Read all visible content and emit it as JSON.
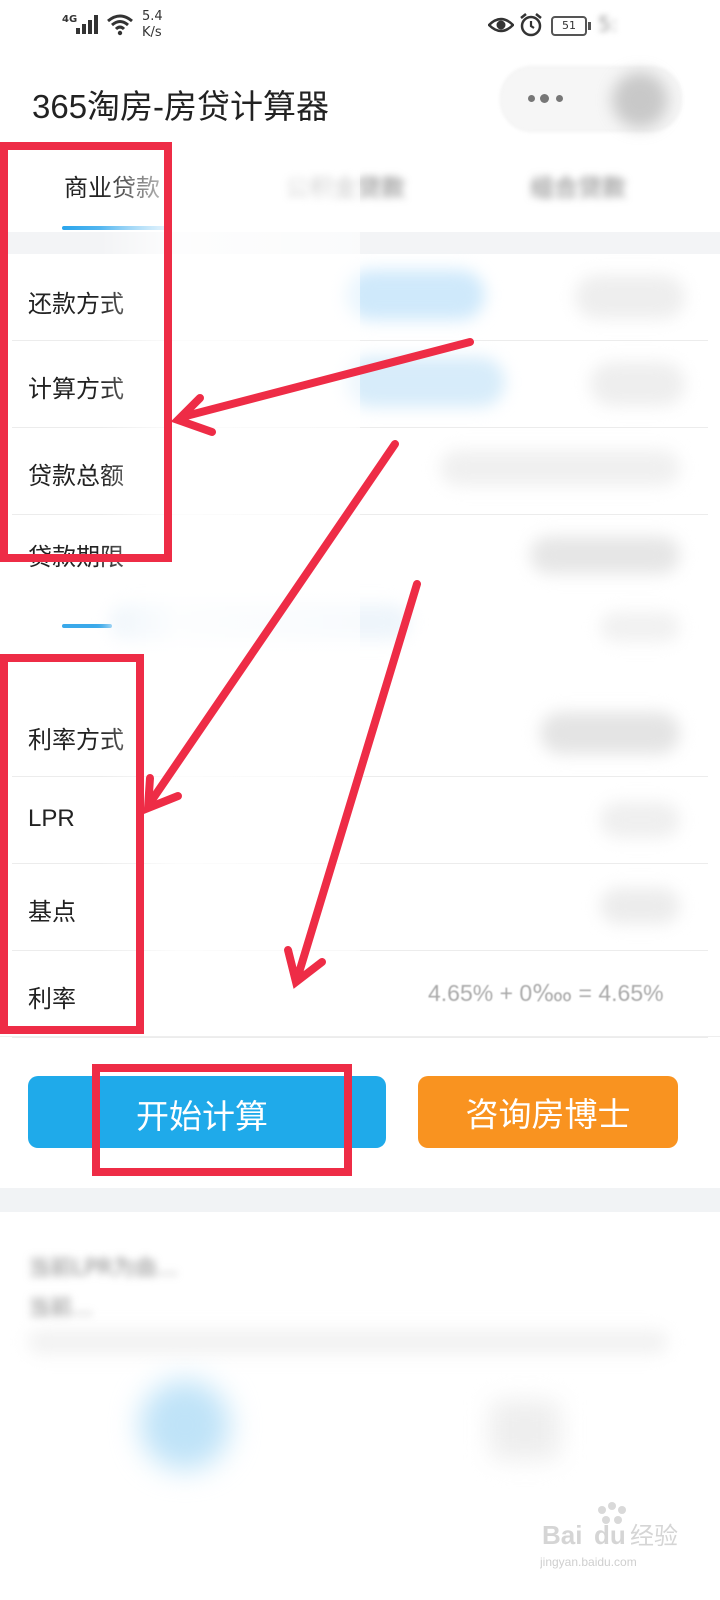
{
  "status_bar": {
    "network": "4G",
    "net_speed": [
      "5.4",
      "K/s"
    ],
    "battery": "51",
    "time": "5:"
  },
  "header": {
    "title": "365淘房-房贷计算器"
  },
  "tabs": [
    {
      "label": "商业贷款",
      "active": true
    },
    {
      "label": "公积金贷款",
      "active": false
    },
    {
      "label": "组合贷款",
      "active": false
    }
  ],
  "form": {
    "rows": [
      {
        "label": "还款方式"
      },
      {
        "label": "计算方式"
      },
      {
        "label": "贷款总额"
      },
      {
        "label": "贷款期限"
      },
      {
        "label": "利率方式"
      },
      {
        "label": "LPR"
      },
      {
        "label": "基点"
      },
      {
        "label": "利率"
      }
    ],
    "rate_formula": "4.65% + 0‱ = 4.65%"
  },
  "buttons": {
    "calculate": "开始计算",
    "consult": "咨询房博士"
  },
  "notes": [
    "当前LPR为由...",
    "当前..."
  ],
  "colors": {
    "primary_blue": "#1faaea",
    "consult_orange": "#f99320",
    "annotation_red": "#ee2c46"
  },
  "watermark": {
    "brand": "Baidu经验",
    "url": "jingyan.baidu.com"
  }
}
